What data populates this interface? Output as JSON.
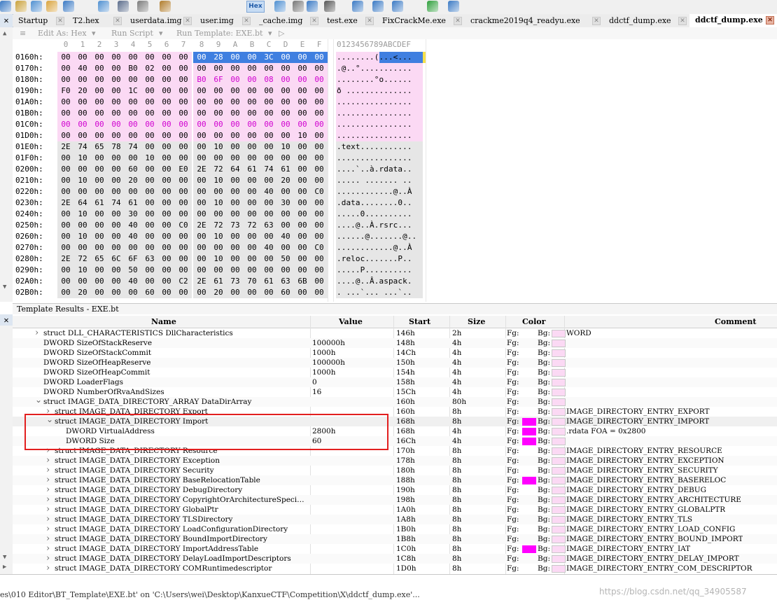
{
  "toolbar": {
    "hex_label": "Hex",
    "icons": [
      "save-icon",
      "copy-icon",
      "paste-icon",
      "find-icon",
      "find-replace-icon",
      "goto-icon",
      "print-icon",
      "font-icon",
      "clear-icon",
      "hex-icon",
      "tools-icon",
      "paragraph-icon",
      "list-icon",
      "binary-icon",
      "calculator-icon",
      "help-icon",
      "compare-icon",
      "chart-icon",
      "checksum-icon"
    ]
  },
  "tabs": [
    {
      "label": "Startup"
    },
    {
      "label": "T2.hex"
    },
    {
      "label": "userdata.img"
    },
    {
      "label": "user.img"
    },
    {
      "label": "_cache.img"
    },
    {
      "label": "test.exe"
    },
    {
      "label": "FixCrackMe.exe"
    },
    {
      "label": "crackme2019q4_readyu.exe"
    },
    {
      "label": "ddctf_dump.exe"
    },
    {
      "label": "ddctf_dump.exe",
      "active": true
    }
  ],
  "editor_bar": {
    "edit_as_label": "Edit As: Hex",
    "run_script_label": "Run Script",
    "run_template_label": "Run Template: EXE.bt"
  },
  "hex": {
    "col_headers": [
      "0",
      "1",
      "2",
      "3",
      "4",
      "5",
      "6",
      "7",
      "8",
      "9",
      "A",
      "B",
      "C",
      "D",
      "E",
      "F"
    ],
    "ascii_header": "0123456789ABCDEF",
    "rows": [
      {
        "addr": "0160h:",
        "bytes": [
          "00",
          "00",
          "00",
          "00",
          "00",
          "00",
          "00",
          "00",
          "00",
          "28",
          "00",
          "00",
          "3C",
          "00",
          "00",
          "00"
        ],
        "ascii": "........(...<..."
      },
      {
        "addr": "0170h:",
        "bytes": [
          "00",
          "40",
          "00",
          "00",
          "B0",
          "02",
          "00",
          "00",
          "00",
          "00",
          "00",
          "00",
          "00",
          "00",
          "00",
          "00"
        ],
        "ascii": ".@..°..........."
      },
      {
        "addr": "0180h:",
        "bytes": [
          "00",
          "00",
          "00",
          "00",
          "00",
          "00",
          "00",
          "00",
          "B0",
          "6F",
          "00",
          "00",
          "08",
          "00",
          "00",
          "00"
        ],
        "ascii": "........°o......"
      },
      {
        "addr": "0190h:",
        "bytes": [
          "F0",
          "20",
          "00",
          "00",
          "1C",
          "00",
          "00",
          "00",
          "00",
          "00",
          "00",
          "00",
          "00",
          "00",
          "00",
          "00"
        ],
        "ascii": "ð .............."
      },
      {
        "addr": "01A0h:",
        "bytes": [
          "00",
          "00",
          "00",
          "00",
          "00",
          "00",
          "00",
          "00",
          "00",
          "00",
          "00",
          "00",
          "00",
          "00",
          "00",
          "00"
        ],
        "ascii": "................"
      },
      {
        "addr": "01B0h:",
        "bytes": [
          "00",
          "00",
          "00",
          "00",
          "00",
          "00",
          "00",
          "00",
          "00",
          "00",
          "00",
          "00",
          "00",
          "00",
          "00",
          "00"
        ],
        "ascii": "................"
      },
      {
        "addr": "01C0h:",
        "bytes": [
          "00",
          "00",
          "00",
          "00",
          "00",
          "00",
          "00",
          "00",
          "00",
          "00",
          "00",
          "00",
          "00",
          "00",
          "00",
          "00"
        ],
        "ascii": "................"
      },
      {
        "addr": "01D0h:",
        "bytes": [
          "00",
          "00",
          "00",
          "00",
          "00",
          "00",
          "00",
          "00",
          "00",
          "00",
          "00",
          "00",
          "00",
          "00",
          "10",
          "00"
        ],
        "ascii": "................"
      },
      {
        "addr": "01E0h:",
        "bytes": [
          "2E",
          "74",
          "65",
          "78",
          "74",
          "00",
          "00",
          "00",
          "00",
          "10",
          "00",
          "00",
          "00",
          "10",
          "00",
          "00"
        ],
        "ascii": ".text..........."
      },
      {
        "addr": "01F0h:",
        "bytes": [
          "00",
          "10",
          "00",
          "00",
          "00",
          "10",
          "00",
          "00",
          "00",
          "00",
          "00",
          "00",
          "00",
          "00",
          "00",
          "00"
        ],
        "ascii": "................"
      },
      {
        "addr": "0200h:",
        "bytes": [
          "00",
          "00",
          "00",
          "00",
          "60",
          "00",
          "00",
          "E0",
          "2E",
          "72",
          "64",
          "61",
          "74",
          "61",
          "00",
          "00"
        ],
        "ascii": "....`..à.rdata.."
      },
      {
        "addr": "0210h:",
        "bytes": [
          "00",
          "10",
          "00",
          "00",
          "20",
          "00",
          "00",
          "00",
          "00",
          "10",
          "00",
          "00",
          "00",
          "20",
          "00",
          "00"
        ],
        "ascii": "..... ....... .."
      },
      {
        "addr": "0220h:",
        "bytes": [
          "00",
          "00",
          "00",
          "00",
          "00",
          "00",
          "00",
          "00",
          "00",
          "00",
          "00",
          "00",
          "40",
          "00",
          "00",
          "C0"
        ],
        "ascii": "............@..À"
      },
      {
        "addr": "0230h:",
        "bytes": [
          "2E",
          "64",
          "61",
          "74",
          "61",
          "00",
          "00",
          "00",
          "00",
          "10",
          "00",
          "00",
          "00",
          "30",
          "00",
          "00"
        ],
        "ascii": ".data........0.."
      },
      {
        "addr": "0240h:",
        "bytes": [
          "00",
          "10",
          "00",
          "00",
          "30",
          "00",
          "00",
          "00",
          "00",
          "00",
          "00",
          "00",
          "00",
          "00",
          "00",
          "00"
        ],
        "ascii": ".....0.........."
      },
      {
        "addr": "0250h:",
        "bytes": [
          "00",
          "00",
          "00",
          "00",
          "40",
          "00",
          "00",
          "C0",
          "2E",
          "72",
          "73",
          "72",
          "63",
          "00",
          "00",
          "00"
        ],
        "ascii": "....@..À.rsrc..."
      },
      {
        "addr": "0260h:",
        "bytes": [
          "00",
          "10",
          "00",
          "00",
          "40",
          "00",
          "00",
          "00",
          "00",
          "10",
          "00",
          "00",
          "00",
          "40",
          "00",
          "00"
        ],
        "ascii": "......@.......@.."
      },
      {
        "addr": "0270h:",
        "bytes": [
          "00",
          "00",
          "00",
          "00",
          "00",
          "00",
          "00",
          "00",
          "00",
          "00",
          "00",
          "00",
          "40",
          "00",
          "00",
          "C0"
        ],
        "ascii": "............@..À"
      },
      {
        "addr": "0280h:",
        "bytes": [
          "2E",
          "72",
          "65",
          "6C",
          "6F",
          "63",
          "00",
          "00",
          "00",
          "10",
          "00",
          "00",
          "00",
          "50",
          "00",
          "00"
        ],
        "ascii": ".reloc.......P.."
      },
      {
        "addr": "0290h:",
        "bytes": [
          "00",
          "10",
          "00",
          "00",
          "50",
          "00",
          "00",
          "00",
          "00",
          "00",
          "00",
          "00",
          "00",
          "00",
          "00",
          "00"
        ],
        "ascii": ".....P.........."
      },
      {
        "addr": "02A0h:",
        "bytes": [
          "00",
          "00",
          "00",
          "00",
          "40",
          "00",
          "00",
          "C2",
          "2E",
          "61",
          "73",
          "70",
          "61",
          "63",
          "6B",
          "00"
        ],
        "ascii": "....@..Â.aspack."
      },
      {
        "addr": "02B0h:",
        "bytes": [
          "00",
          "20",
          "00",
          "00",
          "00",
          "60",
          "00",
          "00",
          "00",
          "20",
          "00",
          "00",
          "00",
          "60",
          "00",
          "00"
        ],
        "ascii": ". ...`... ...`.."
      }
    ]
  },
  "template": {
    "title": "Template Results - EXE.bt",
    "headers": {
      "name": "Name",
      "value": "Value",
      "start": "Start",
      "size": "Size",
      "color": "Color",
      "comment": "Comment"
    },
    "fg_label": "Fg:",
    "bg_label": "Bg:",
    "rows": [
      {
        "indent": 1,
        "arrow": ">",
        "name": "struct DLL_CHARACTERISTICS DllCharacteristics",
        "value": "",
        "start": "146h",
        "size": "2h",
        "bg": "#fbd9f4",
        "comment": "WORD"
      },
      {
        "indent": 1,
        "arrow": "",
        "name": "DWORD SizeOfStackReserve",
        "value": "100000h",
        "start": "148h",
        "size": "4h",
        "bg": "#fbd9f4",
        "comment": ""
      },
      {
        "indent": 1,
        "arrow": "",
        "name": "DWORD SizeOfStackCommit",
        "value": "1000h",
        "start": "14Ch",
        "size": "4h",
        "bg": "#fbd9f4",
        "comment": ""
      },
      {
        "indent": 1,
        "arrow": "",
        "name": "DWORD SizeOfHeapReserve",
        "value": "100000h",
        "start": "150h",
        "size": "4h",
        "bg": "#fbd9f4",
        "comment": ""
      },
      {
        "indent": 1,
        "arrow": "",
        "name": "DWORD SizeOfHeapCommit",
        "value": "1000h",
        "start": "154h",
        "size": "4h",
        "bg": "#fbd9f4",
        "comment": ""
      },
      {
        "indent": 1,
        "arrow": "",
        "name": "DWORD LoaderFlags",
        "value": "0",
        "start": "158h",
        "size": "4h",
        "bg": "#fbd9f4",
        "comment": ""
      },
      {
        "indent": 1,
        "arrow": "",
        "name": "DWORD NumberOfRvaAndSizes",
        "value": "16",
        "start": "15Ch",
        "size": "4h",
        "bg": "#fbd9f4",
        "comment": ""
      },
      {
        "indent": 1,
        "arrow": "v",
        "name": "struct IMAGE_DATA_DIRECTORY_ARRAY DataDirArray",
        "value": "",
        "start": "160h",
        "size": "80h",
        "bg": "#fbd9f4",
        "comment": ""
      },
      {
        "indent": 2,
        "arrow": ">",
        "name": "struct IMAGE_DATA_DIRECTORY Export",
        "value": "",
        "start": "160h",
        "size": "8h",
        "bg": "#fbd9f4",
        "comment": "IMAGE_DIRECTORY_ENTRY_EXPORT"
      },
      {
        "indent": 2,
        "arrow": "v",
        "name": "struct IMAGE_DATA_DIRECTORY Import",
        "value": "",
        "start": "168h",
        "size": "8h",
        "fg": "#ff00ff",
        "bg": "#fbd9f4",
        "comment": "IMAGE_DIRECTORY_ENTRY_IMPORT",
        "sel": true
      },
      {
        "indent": 3,
        "arrow": "",
        "name": "DWORD VirtualAddress",
        "value": "2800h",
        "start": "168h",
        "size": "4h",
        "fg": "#ff00ff",
        "bg": "#fbd9f4",
        "comment": ".rdata FOA = 0x2800"
      },
      {
        "indent": 3,
        "arrow": "",
        "name": "DWORD Size",
        "value": "60",
        "start": "16Ch",
        "size": "4h",
        "fg": "#ff00ff",
        "bg": "#fbd9f4",
        "comment": ""
      },
      {
        "indent": 2,
        "arrow": ">",
        "name": "struct IMAGE_DATA_DIRECTORY Resource",
        "value": "",
        "start": "170h",
        "size": "8h",
        "bg": "#fbd9f4",
        "comment": "IMAGE_DIRECTORY_ENTRY_RESOURCE"
      },
      {
        "indent": 2,
        "arrow": ">",
        "name": "struct IMAGE_DATA_DIRECTORY Exception",
        "value": "",
        "start": "178h",
        "size": "8h",
        "bg": "#fbd9f4",
        "comment": "IMAGE_DIRECTORY_ENTRY_EXCEPTION"
      },
      {
        "indent": 2,
        "arrow": ">",
        "name": "struct IMAGE_DATA_DIRECTORY Security",
        "value": "",
        "start": "180h",
        "size": "8h",
        "bg": "#fbd9f4",
        "comment": "IMAGE_DIRECTORY_ENTRY_SECURITY"
      },
      {
        "indent": 2,
        "arrow": ">",
        "name": "struct IMAGE_DATA_DIRECTORY BaseRelocationTable",
        "value": "",
        "start": "188h",
        "size": "8h",
        "fg": "#ff00ff",
        "bg": "#fbd9f4",
        "comment": "IMAGE_DIRECTORY_ENTRY_BASERELOC"
      },
      {
        "indent": 2,
        "arrow": ">",
        "name": "struct IMAGE_DATA_DIRECTORY DebugDirectory",
        "value": "",
        "start": "190h",
        "size": "8h",
        "bg": "#fbd9f4",
        "comment": "IMAGE_DIRECTORY_ENTRY_DEBUG"
      },
      {
        "indent": 2,
        "arrow": ">",
        "name": "struct IMAGE_DATA_DIRECTORY CopyrightOrArchitectureSpeci…",
        "value": "",
        "start": "198h",
        "size": "8h",
        "bg": "#fbd9f4",
        "comment": "IMAGE_DIRECTORY_ENTRY_ARCHITECTURE"
      },
      {
        "indent": 2,
        "arrow": ">",
        "name": "struct IMAGE_DATA_DIRECTORY GlobalPtr",
        "value": "",
        "start": "1A0h",
        "size": "8h",
        "bg": "#fbd9f4",
        "comment": "IMAGE_DIRECTORY_ENTRY_GLOBALPTR"
      },
      {
        "indent": 2,
        "arrow": ">",
        "name": "struct IMAGE_DATA_DIRECTORY TLSDirectory",
        "value": "",
        "start": "1A8h",
        "size": "8h",
        "bg": "#fbd9f4",
        "comment": "IMAGE_DIRECTORY_ENTRY_TLS"
      },
      {
        "indent": 2,
        "arrow": ">",
        "name": "struct IMAGE_DATA_DIRECTORY LoadConfigurationDirectory",
        "value": "",
        "start": "1B0h",
        "size": "8h",
        "bg": "#fbd9f4",
        "comment": "IMAGE_DIRECTORY_ENTRY_LOAD_CONFIG"
      },
      {
        "indent": 2,
        "arrow": ">",
        "name": "struct IMAGE_DATA_DIRECTORY BoundImportDirectory",
        "value": "",
        "start": "1B8h",
        "size": "8h",
        "bg": "#fbd9f4",
        "comment": "IMAGE_DIRECTORY_ENTRY_BOUND_IMPORT"
      },
      {
        "indent": 2,
        "arrow": ">",
        "name": "struct IMAGE_DATA_DIRECTORY ImportAddressTable",
        "value": "",
        "start": "1C0h",
        "size": "8h",
        "fg": "#ff00ff",
        "bg": "#fbd9f4",
        "comment": "IMAGE_DIRECTORY_ENTRY_IAT"
      },
      {
        "indent": 2,
        "arrow": ">",
        "name": "struct IMAGE_DATA_DIRECTORY DelayLoadImportDescriptors",
        "value": "",
        "start": "1C8h",
        "size": "8h",
        "bg": "#fbd9f4",
        "comment": "IMAGE_DIRECTORY_ENTRY_DELAY_IMPORT"
      },
      {
        "indent": 2,
        "arrow": ">",
        "name": "struct IMAGE_DATA_DIRECTORY COMRuntimedescriptor",
        "value": "",
        "start": "1D0h",
        "size": "8h",
        "bg": "#fbd9f4",
        "comment": "IMAGE_DIRECTORY_ENTRY_COM_DESCRIPTOR"
      }
    ]
  },
  "status": {
    "text": "es\\010 Editor\\BT_Template\\EXE.bt' on 'C:\\Users\\wei\\Desktop\\KanxueCTF\\Competition\\X\\ddctf_dump.exe'...",
    "watermark": "https://blog.csdn.net/qq_34905587"
  },
  "colors": {
    "selection": "#3f7fe0",
    "pink_row": "#fbd9f4",
    "gray_row": "#e6e6e6",
    "magenta": "#ff00ff",
    "highlight_box": "#e21f1f"
  }
}
